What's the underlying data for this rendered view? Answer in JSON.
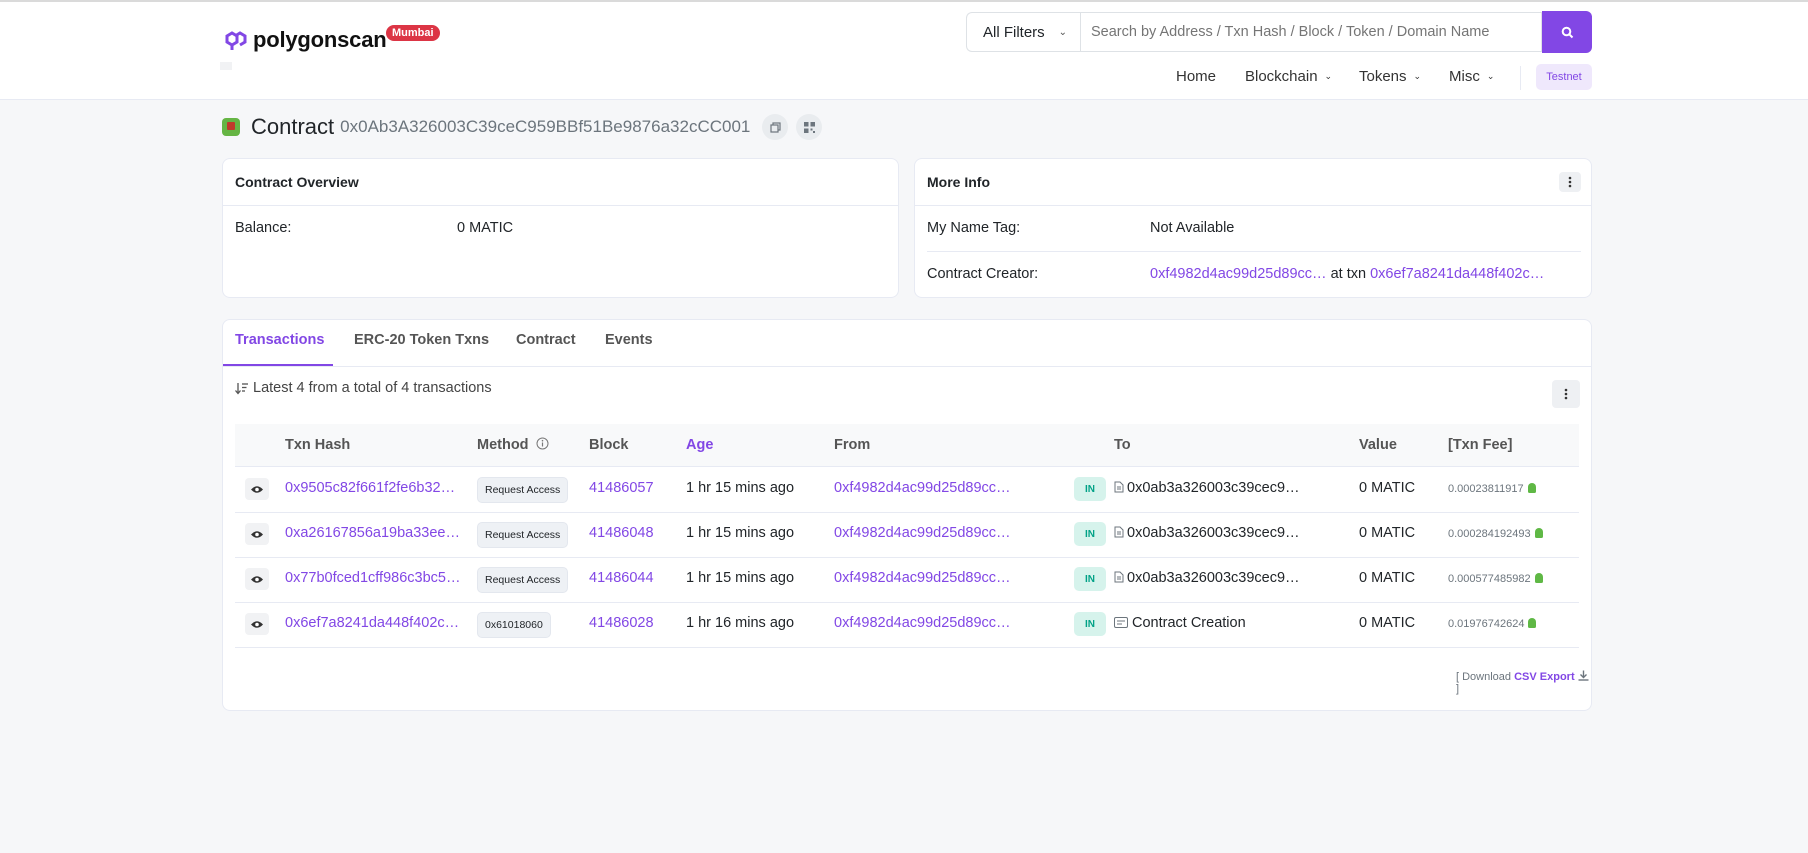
{
  "header": {
    "brand": "polygonscan",
    "network_badge": "Mumbai",
    "filter_label": "All Filters",
    "search_placeholder": "Search by Address / Txn Hash / Block / Token / Domain Name",
    "nav": [
      "Home",
      "Blockchain",
      "Tokens",
      "Misc"
    ],
    "testnet_label": "Testnet"
  },
  "title": {
    "label": "Contract",
    "address": "0x0Ab3A326003C39ceC959BBf51Be9876a32cCC001"
  },
  "overview": {
    "heading": "Contract Overview",
    "balance_label": "Balance:",
    "balance_value": "0 MATIC"
  },
  "more_info": {
    "heading": "More Info",
    "name_tag_label": "My Name Tag:",
    "name_tag_value": "Not Available",
    "creator_label": "Contract Creator:",
    "creator_address": "0xf4982d4ac99d25d89cc…",
    "at_txn": "at txn",
    "creator_txn": "0x6ef7a8241da448f402c…"
  },
  "tabs": [
    "Transactions",
    "ERC-20 Token Txns",
    "Contract",
    "Events"
  ],
  "summary": "Latest 4 from a total of 4 transactions",
  "table": {
    "headers": [
      "Txn Hash",
      "Method",
      "Block",
      "Age",
      "From",
      "To",
      "Value",
      "[Txn Fee]"
    ],
    "rows": [
      {
        "hash": "0x9505c82f661f2fe6b32…",
        "method": "Request Access",
        "block": "41486057",
        "age": "1 hr 15 mins ago",
        "from": "0xf4982d4ac99d25d89cc…",
        "direction": "IN",
        "to": "0x0ab3a326003c39cec9…",
        "value": "0 MATIC",
        "fee": "0.00023811917"
      },
      {
        "hash": "0xa26167856a19ba33ee…",
        "method": "Request Access",
        "block": "41486048",
        "age": "1 hr 15 mins ago",
        "from": "0xf4982d4ac99d25d89cc…",
        "direction": "IN",
        "to": "0x0ab3a326003c39cec9…",
        "value": "0 MATIC",
        "fee": "0.000284192493"
      },
      {
        "hash": "0x77b0fced1cff986c3bc5…",
        "method": "Request Access",
        "block": "41486044",
        "age": "1 hr 15 mins ago",
        "from": "0xf4982d4ac99d25d89cc…",
        "direction": "IN",
        "to": "0x0ab3a326003c39cec9…",
        "value": "0 MATIC",
        "fee": "0.000577485982"
      },
      {
        "hash": "0x6ef7a8241da448f402c…",
        "method": "0x61018060",
        "block": "41486028",
        "age": "1 hr 16 mins ago",
        "from": "0xf4982d4ac99d25d89cc…",
        "direction": "IN",
        "to": "Contract Creation",
        "value": "0 MATIC",
        "fee": "0.01976742624"
      }
    ]
  },
  "csv": {
    "prefix": "[ Download",
    "link": "CSV Export",
    "suffix": "]"
  },
  "colors": {
    "accent": "#8247e5",
    "in_badge_bg": "#d6f3ec",
    "in_badge_text": "#00a186",
    "network_badge": "#dc3545"
  }
}
